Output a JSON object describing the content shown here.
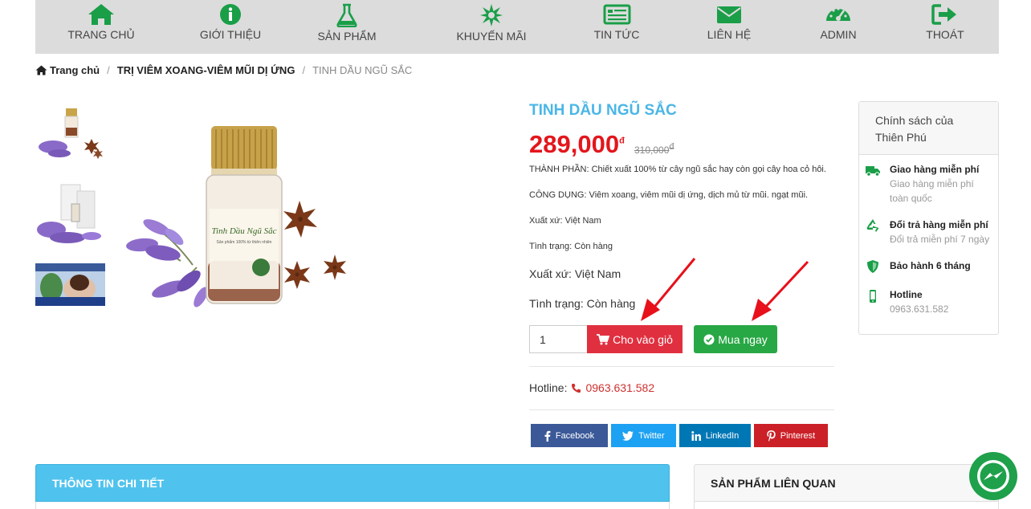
{
  "colors": {
    "nav_icon": "#1a9e48",
    "title": "#4ab6e6",
    "price": "#e3161c",
    "cart_button": "#e03040",
    "buy_button": "#28a745",
    "policy_icon": "#1a9e48",
    "arrow": "#e8101a",
    "facebook": "#3b5998",
    "twitter": "#1da1f2",
    "linkedin": "#0077b5",
    "pinterest": "#cb2027"
  },
  "nav": {
    "items": [
      {
        "label": "TRANG CHỦ",
        "icon": "home-icon"
      },
      {
        "label": "GIỚI THIỆU",
        "icon": "info-icon"
      },
      {
        "label": "SẢN PHẨM",
        "icon": "flask-icon"
      },
      {
        "label": "KHUYẾN MÃI",
        "icon": "burst-icon"
      },
      {
        "label": "TIN TỨC",
        "icon": "newspaper-icon"
      },
      {
        "label": "LIÊN HỆ",
        "icon": "envelope-icon"
      },
      {
        "label": "ADMIN",
        "icon": "dashboard-icon"
      },
      {
        "label": "THOÁT",
        "icon": "sign-out-icon"
      }
    ]
  },
  "breadcrumb": {
    "home": "Trang chủ",
    "category": "TRỊ VIÊM XOANG-VIÊM MŨI DỊ ỨNG",
    "current": "TINH DẦU NGŨ SẮC"
  },
  "product": {
    "name": "TINH DẦU NGŨ SẮC",
    "price": "289,000",
    "currency": "đ",
    "old_price": "310,000",
    "ingredients": "THÀNH PHẦN: Chiết xuất 100% từ cây ngũ sắc hay còn gọi cây hoa cỏ hôi.",
    "uses": "CÔNG DỤNG: Viêm xoang, viêm mũi dị ứng, dịch mủ từ mũi. ngạt mũi.",
    "origin_small": "Xuất xứ: Việt Nam",
    "status_small": "Tình trạng: Còn hàng",
    "origin": "Xuất xứ: Việt Nam",
    "status": "Tình trạng: Còn hàng",
    "quantity": "1",
    "add_to_cart": "Cho vào giỏ",
    "buy_now": "Mua ngay",
    "hotline_label": "Hotline:",
    "hotline_number": "0963.631.582",
    "bottle_label_title": "Tinh Dầu Ngũ Sắc",
    "bottle_label_sub": "Sản phẩm 100% từ thiên nhiên"
  },
  "share": {
    "facebook": "Facebook",
    "twitter": "Twitter",
    "linkedin": "LinkedIn",
    "pinterest": "Pinterest"
  },
  "policy": {
    "title": "Chính sách của Thiên Phú",
    "items": [
      {
        "icon": "truck-icon",
        "title": "Giao hàng miễn phí",
        "desc": "Giao hàng miễn phí toàn quốc"
      },
      {
        "icon": "recycle-icon",
        "title": "Đổi trả hàng miễn phí",
        "desc": "Đổi trả miễn phí 7 ngày"
      },
      {
        "icon": "shield-icon",
        "title": "Bảo hành 6 tháng",
        "desc": ""
      },
      {
        "icon": "mobile-icon",
        "title": "Hotline",
        "desc": "0963.631.582"
      }
    ]
  },
  "tabs": {
    "detail": "THÔNG TIN CHI TIẾT",
    "related": "SẢN PHẨM LIÊN QUAN"
  }
}
